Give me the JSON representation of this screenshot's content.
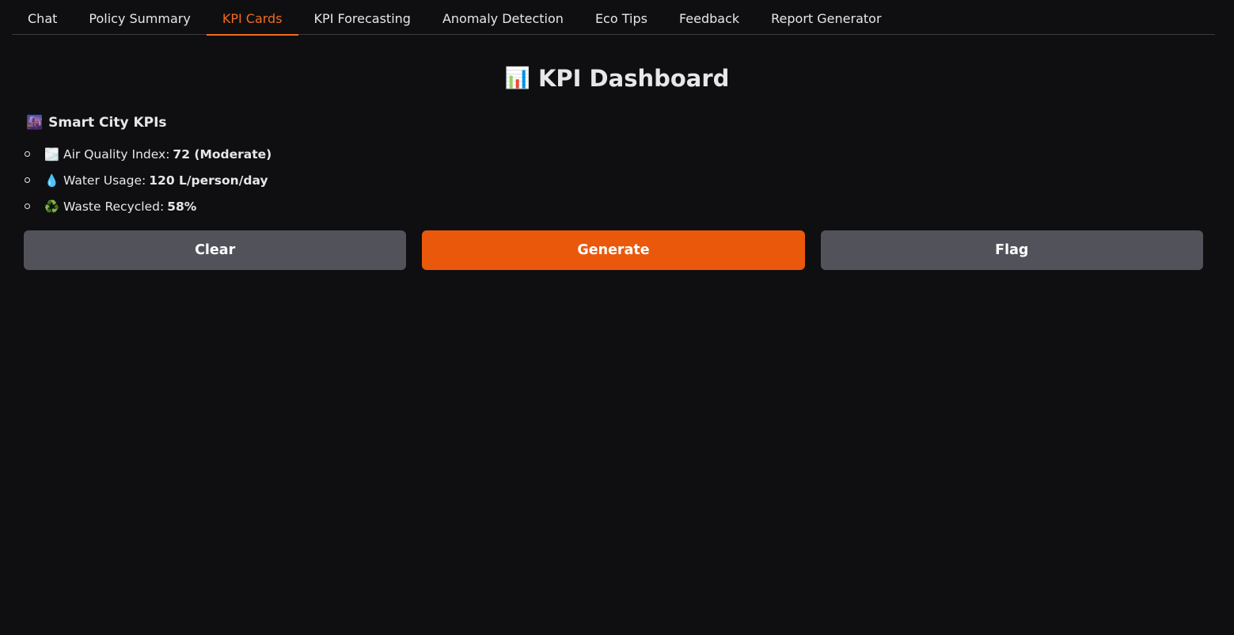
{
  "tabs": [
    {
      "label": "Chat",
      "active": false
    },
    {
      "label": "Policy Summary",
      "active": false
    },
    {
      "label": "KPI Cards",
      "active": true
    },
    {
      "label": "KPI Forecasting",
      "active": false
    },
    {
      "label": "Anomaly Detection",
      "active": false
    },
    {
      "label": "Eco Tips",
      "active": false
    },
    {
      "label": "Feedback",
      "active": false
    },
    {
      "label": "Report Generator",
      "active": false
    }
  ],
  "page": {
    "title_icon": "📊",
    "title": "KPI Dashboard"
  },
  "section": {
    "icon": "🌆",
    "heading": "Smart City KPIs",
    "items": [
      {
        "icon": "🌫️",
        "label": "Air Quality Index:",
        "value": "72 (Moderate)"
      },
      {
        "icon": "💧",
        "label": "Water Usage:",
        "value": "120 L/person/day"
      },
      {
        "icon": "♻️",
        "label": "Waste Recycled:",
        "value": "58%"
      }
    ]
  },
  "buttons": {
    "clear": "Clear",
    "generate": "Generate",
    "flag": "Flag"
  },
  "colors": {
    "accent": "#f26b1f",
    "primary_button": "#ea580c",
    "secondary_button": "#52525b",
    "background": "#0f0f11"
  }
}
